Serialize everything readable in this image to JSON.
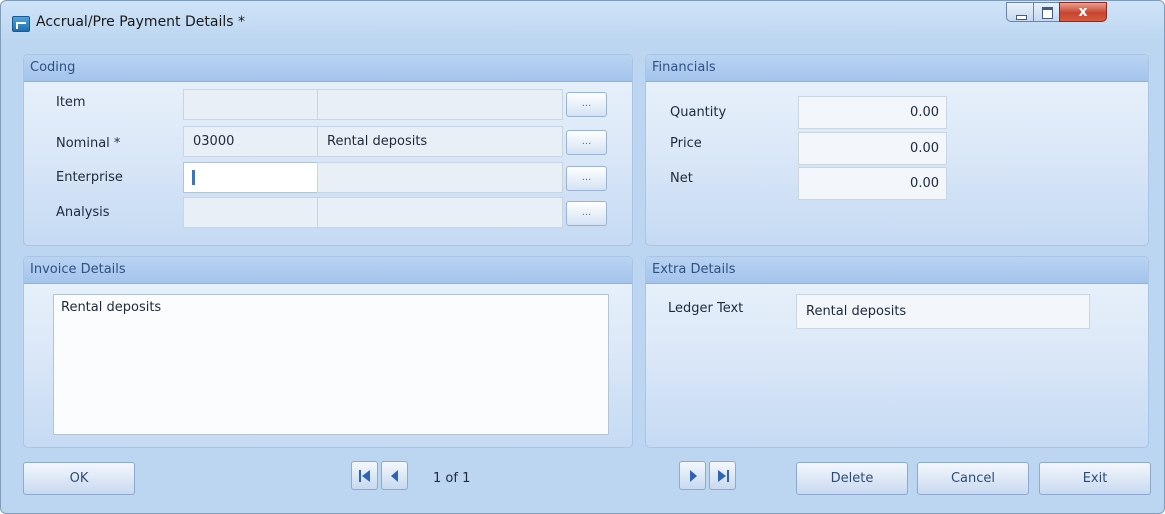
{
  "window": {
    "title": "Accrual/Pre Payment Details *",
    "close_glyph": "x"
  },
  "coding": {
    "header": "Coding",
    "rows": [
      {
        "label": "Item",
        "code": "",
        "description": ""
      },
      {
        "label": "Nominal *",
        "code": "03000",
        "description": "Rental deposits"
      },
      {
        "label": "Enterprise",
        "code": "",
        "description": ""
      },
      {
        "label": "Analysis",
        "code": "",
        "description": ""
      }
    ],
    "lookup_label": "..."
  },
  "financials": {
    "header": "Financials",
    "quantity_label": "Quantity",
    "quantity": "0.00",
    "price_label": "Price",
    "price": "0.00",
    "net_label": "Net",
    "net": "0.00"
  },
  "invoice": {
    "header": "Invoice Details",
    "text": "Rental deposits"
  },
  "extra": {
    "header": "Extra Details",
    "ledger_label": "Ledger Text",
    "ledger_text": "Rental deposits"
  },
  "footer": {
    "ok": "OK",
    "page_indicator": "1 of 1",
    "delete": "Delete",
    "cancel": "Cancel",
    "exit": "Exit"
  },
  "icons": [
    "app-icon",
    "minimize-icon",
    "maximize-icon",
    "close-icon",
    "first-record-icon",
    "previous-record-icon",
    "next-record-icon",
    "last-record-icon"
  ],
  "colors": {
    "accent": "#2d5181",
    "panel_header": "#a4c4ec",
    "close_button": "#c8442e"
  }
}
